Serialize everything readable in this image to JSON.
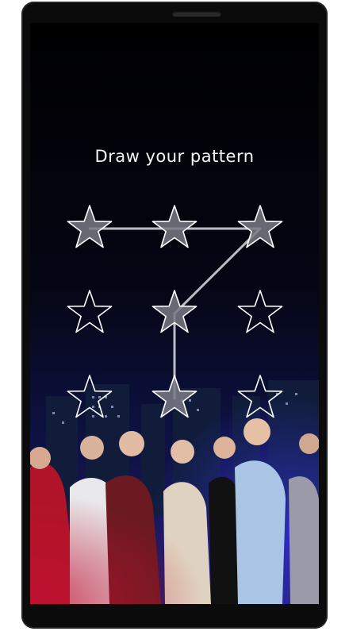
{
  "lock_screen": {
    "title": "Draw your pattern",
    "pattern_icon": "star-icon",
    "grid_size": 3,
    "selected_nodes": [
      0,
      1,
      2,
      4,
      7
    ],
    "colors": {
      "star_outline": "#ffffff",
      "star_selected_fill": "#7a7a86",
      "path_line": "#cfcfd6",
      "background_top": "#000000",
      "background_bottom": "#14184a"
    }
  }
}
